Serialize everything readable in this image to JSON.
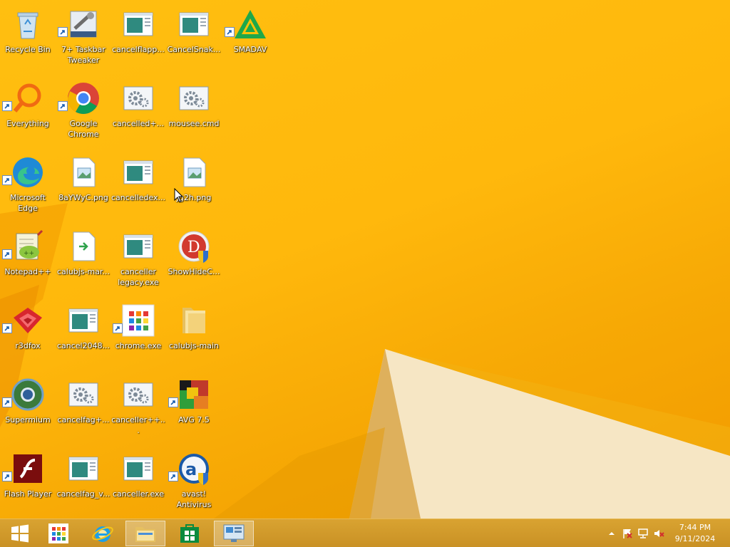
{
  "desktop": {
    "icons": [
      {
        "label": "Recycle Bin"
      },
      {
        "label": "7+ Taskbar Tweaker"
      },
      {
        "label": "cancelflapp..."
      },
      {
        "label": "CancelSnak..."
      },
      {
        "label": "SMADAV"
      },
      {
        "label": "Everything"
      },
      {
        "label": "Google Chrome"
      },
      {
        "label": "cancelled+..."
      },
      {
        "label": "mousee.cmd"
      },
      {
        "label": "Microsoft Edge"
      },
      {
        "label": "8aYWyC.png"
      },
      {
        "label": "cancelledex..."
      },
      {
        "label": "Jg2h.png"
      },
      {
        "label": "Notepad++"
      },
      {
        "label": "calubjs-mar..."
      },
      {
        "label": "canceller legacy.exe"
      },
      {
        "label": "ShowHideC..."
      },
      {
        "label": "r3dfox"
      },
      {
        "label": "cancel2048..."
      },
      {
        "label": "chrome.exe"
      },
      {
        "label": "calubjs-main"
      },
      {
        "label": "Supermium"
      },
      {
        "label": "cancelfag+..."
      },
      {
        "label": "canceller++..."
      },
      {
        "label": "AVG 7.5"
      },
      {
        "label": "Flash Player"
      },
      {
        "label": "cancelfag_v..."
      },
      {
        "label": "canceller.exe"
      },
      {
        "label": "avast! Antivirus"
      }
    ]
  },
  "taskbar": {
    "buttons": [
      {
        "icon": "windows-start-icon"
      },
      {
        "icon": "app-grid-icon"
      },
      {
        "icon": "internet-explorer-icon"
      },
      {
        "icon": "file-explorer-icon"
      },
      {
        "icon": "store-icon"
      },
      {
        "icon": "control-panel-icon"
      }
    ],
    "tray": {
      "icons": [
        "show-hidden-icons-chevron",
        "action-center-flag-icon",
        "network-icon",
        "volume-muted-icon"
      ],
      "time": "7:44 PM",
      "date": "9/11/2024"
    }
  },
  "colors": {
    "wallpaper": "#ffb80c",
    "taskbar": "#d19b2b",
    "label_text": "#ffffff"
  }
}
